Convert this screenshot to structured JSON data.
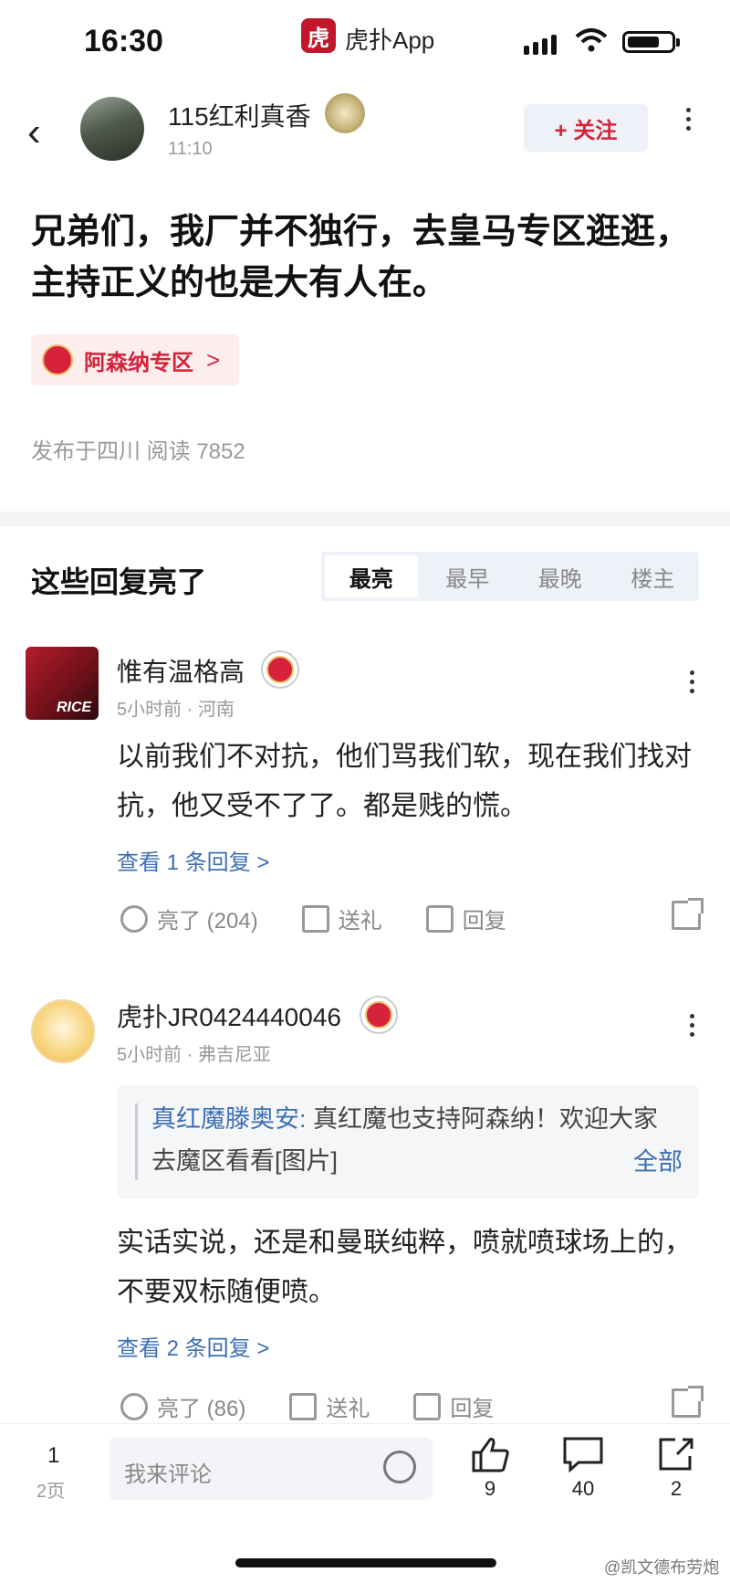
{
  "status_bar": {
    "time": "16:30",
    "app_logo_char": "虎",
    "app_name": "虎扑App"
  },
  "header": {
    "author": "115红利真香",
    "post_time": "11:10",
    "follow_label": "+ 关注"
  },
  "post": {
    "title": "兄弟们，我厂并不独行，去皇马专区逛逛，主持正义的也是大有人在。",
    "zone_label": "阿森纳专区",
    "zone_chevron": ">",
    "meta": "发布于四川   阅读 7852"
  },
  "replies": {
    "title": "这些回复亮了",
    "tabs": [
      "最亮",
      "最早",
      "最晚",
      "楼主"
    ],
    "active_tab": "最亮"
  },
  "comments": [
    {
      "name": "惟有温格高",
      "sub": "5小时前 · 河南",
      "text": "以前我们不对抗，他们骂我们软，现在我们找对抗，他又受不了了。都是贱的慌。",
      "view_replies": "查看 1 条回复 >",
      "like": "亮了 (204)",
      "gift": "送礼",
      "reply": "回复",
      "avatar_text": "RICE"
    },
    {
      "name": "虎扑JR0424440046",
      "sub": "5小时前 · 弗吉尼亚",
      "quote_name": "真红魔滕奥安:",
      "quote_text": " 真红魔也支持阿森纳！欢迎大家去魔区看看[图片]",
      "quote_all": "全部",
      "text": "实话实说，还是和曼联纯粹，喷就喷球场上的，不要双标随便喷。",
      "view_replies": "查看 2 条回复 >",
      "like": "亮了 (86)",
      "gift": "送礼",
      "reply": "回复"
    }
  ],
  "bottom_bar": {
    "page_current": "1",
    "page_total": "2页",
    "comment_placeholder": "我来评论",
    "likes": "9",
    "comments": "40",
    "shares": "2"
  },
  "watermark": "@凯文德布劳炮"
}
